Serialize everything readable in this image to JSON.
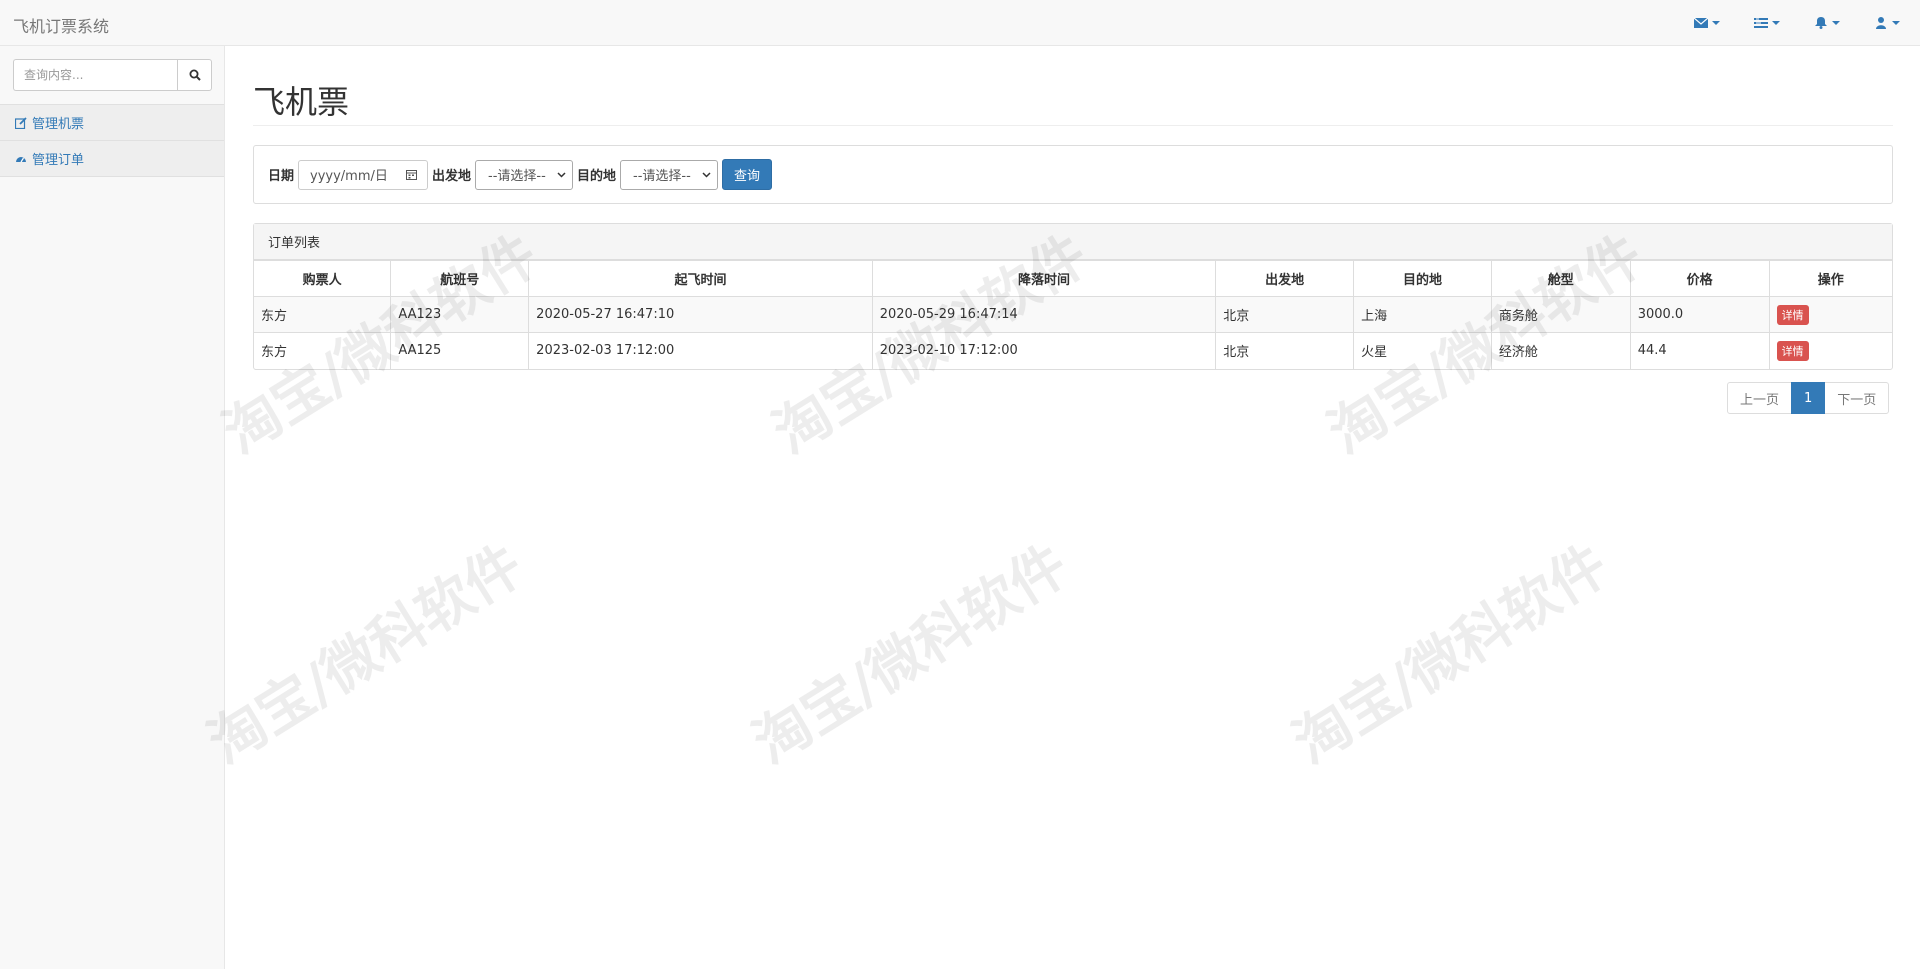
{
  "navbar": {
    "brand": "飞机订票系统",
    "icons": [
      "envelope-icon",
      "tasks-icon",
      "bell-icon",
      "user-icon"
    ]
  },
  "sidebar": {
    "search_placeholder": "查询内容...",
    "items": [
      {
        "label": "管理机票",
        "icon": "edit-icon"
      },
      {
        "label": "管理订单",
        "icon": "dashboard-icon"
      }
    ]
  },
  "main": {
    "title": "飞机票",
    "filter": {
      "date_label": "日期",
      "date_placeholder": "yyyy/mm/日",
      "departure_label": "出发地",
      "departure_value": "--请选择--",
      "destination_label": "目的地",
      "destination_value": "--请选择--",
      "query_label": "查询"
    },
    "orders": {
      "heading": "订单列表",
      "columns": [
        "购票人",
        "航班号",
        "起飞时间",
        "降落时间",
        "出发地",
        "目的地",
        "舱型",
        "价格",
        "操作"
      ],
      "rows": [
        [
          "东方",
          "AA123",
          "2020-05-27 16:47:10",
          "2020-05-29 16:47:14",
          "北京",
          "上海",
          "商务舱",
          "3000.0",
          "详情"
        ],
        [
          "东方",
          "AA125",
          "2023-02-03 17:12:00",
          "2023-02-10 17:12:00",
          "北京",
          "火星",
          "经济舱",
          "44.4",
          "详情"
        ]
      ]
    },
    "pagination": {
      "prev": "上一页",
      "current": "1",
      "next": "下一页"
    }
  },
  "watermark_text": "淘宝/微科软件",
  "colors": {
    "accent": "#337ab7",
    "danger": "#d9534f"
  }
}
